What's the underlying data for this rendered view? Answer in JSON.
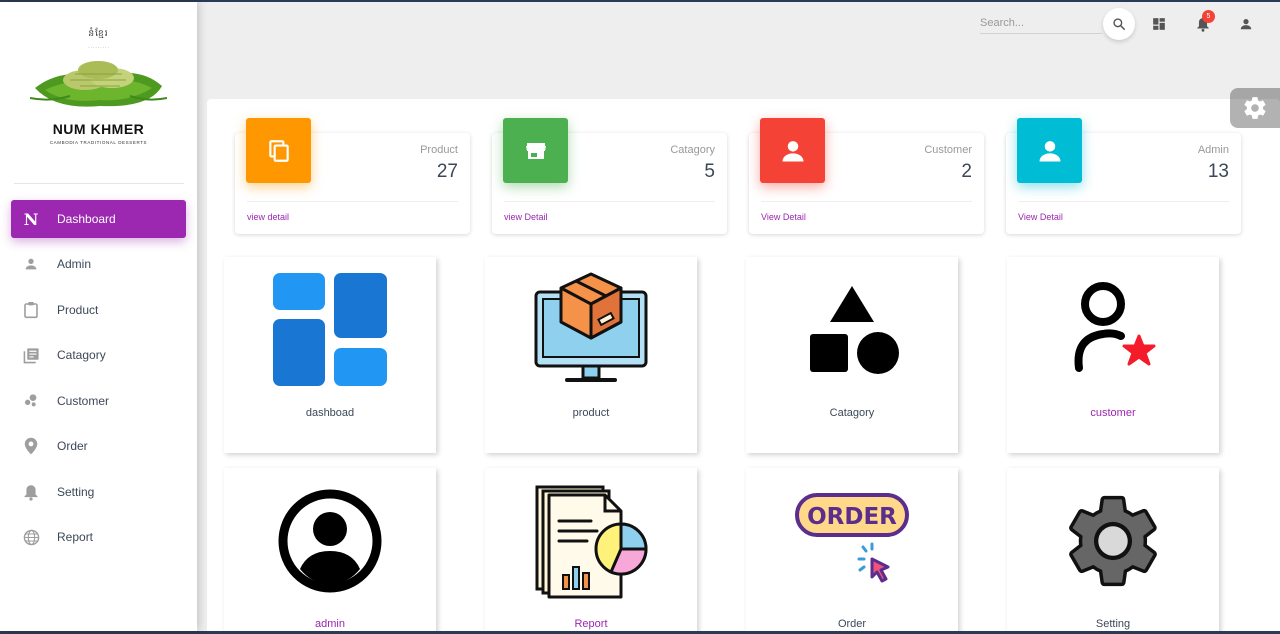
{
  "sidebar": {
    "logo_script": "នំខ្មែរ",
    "logo_title": "NUM KHMER",
    "logo_tagline": "CAMBODIA TRADITIONAL DESSERTS",
    "items": [
      {
        "label": "Dashboard",
        "icon": "n-logo-icon",
        "active": true
      },
      {
        "label": "Admin",
        "icon": "person-icon"
      },
      {
        "label": "Product",
        "icon": "clipboard-icon"
      },
      {
        "label": "Catagory",
        "icon": "library-books-icon"
      },
      {
        "label": "Customer",
        "icon": "bubble-chart-icon"
      },
      {
        "label": "Order",
        "icon": "location-pin-icon"
      },
      {
        "label": "Setting",
        "icon": "bell-icon"
      },
      {
        "label": "Report",
        "icon": "globe-icon"
      }
    ]
  },
  "topbar": {
    "search_placeholder": "Search...",
    "notification_count": "5"
  },
  "stats": [
    {
      "label": "Product",
      "value": "27",
      "link": "view detail",
      "color": "#ff9800",
      "icon": "copy-icon"
    },
    {
      "label": "Catagory",
      "value": "5",
      "link": "view Detail",
      "color": "#4caf50",
      "icon": "store-icon"
    },
    {
      "label": "Customer",
      "value": "2",
      "link": "View Detail",
      "color": "#f44336",
      "icon": "person-icon"
    },
    {
      "label": "Admin",
      "value": "13",
      "link": "View Detail",
      "color": "#00bcd4",
      "icon": "person-icon"
    }
  ],
  "tiles": [
    {
      "label": "dashboad",
      "icon": "dashboard-grid-icon"
    },
    {
      "label": "product",
      "icon": "product-monitor-icon"
    },
    {
      "label": "Catagory",
      "icon": "shapes-icon"
    },
    {
      "label": "customer",
      "icon": "user-star-icon"
    },
    {
      "label": "admin",
      "icon": "user-circle-icon"
    },
    {
      "label": "Report",
      "icon": "report-icon"
    },
    {
      "label": "Order",
      "icon": "order-click-icon"
    },
    {
      "label": "Setting",
      "icon": "gear-icon"
    }
  ],
  "colors": {
    "accent": "#9c27b0"
  }
}
